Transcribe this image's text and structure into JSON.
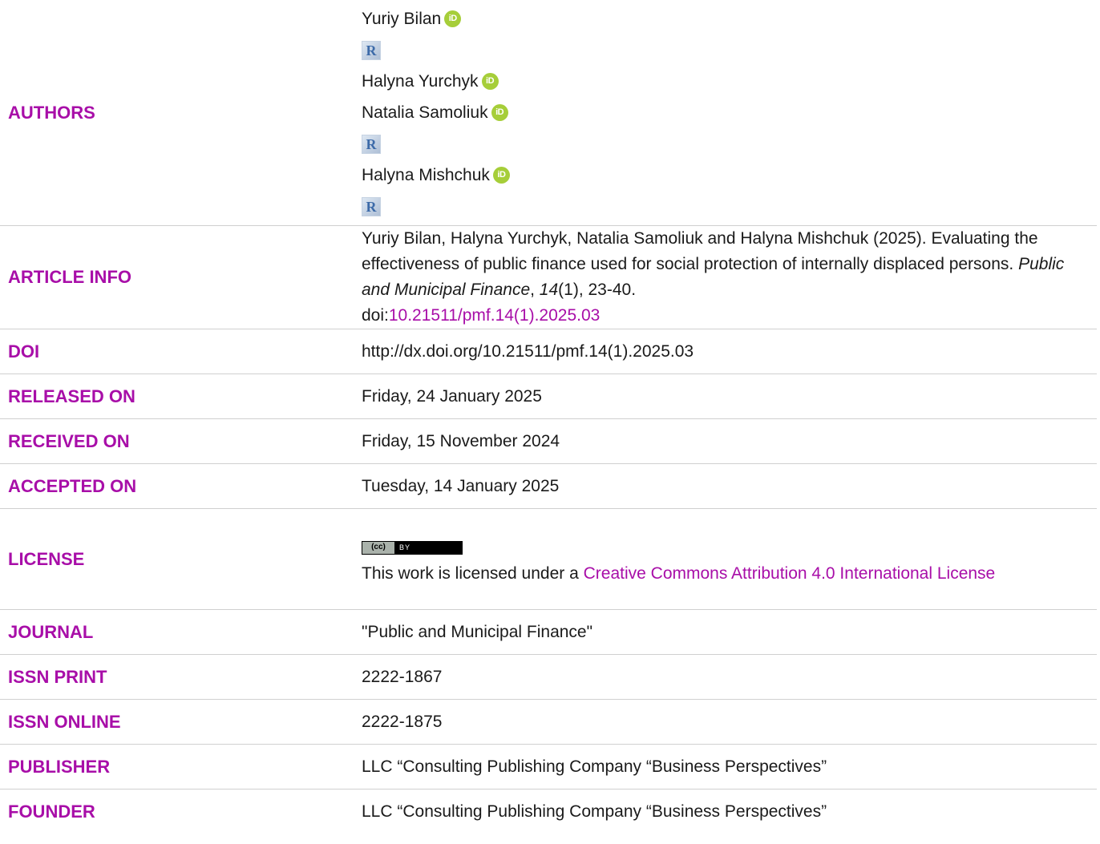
{
  "labels": {
    "authors": "AUTHORS",
    "article_info": "ARTICLE INFO",
    "doi": "DOI",
    "released_on": "RELEASED ON",
    "received_on": "RECEIVED ON",
    "accepted_on": "ACCEPTED ON",
    "license": "LICENSE",
    "journal": "JOURNAL",
    "issn_print": "ISSN PRINT",
    "issn_online": "ISSN ONLINE",
    "publisher": "PUBLISHER",
    "founder": "FOUNDER"
  },
  "authors": [
    {
      "name": "Yuriy Bilan",
      "orcid": "iD",
      "researcher_id": "R"
    },
    {
      "name": "Halyna Yurchyk",
      "orcid": "iD"
    },
    {
      "name": "Natalia Samoliuk",
      "orcid": "iD",
      "researcher_id": "R"
    },
    {
      "name": "Halyna Mishchuk",
      "orcid": "iD",
      "researcher_id": "R"
    }
  ],
  "article_info": {
    "citation_prefix": "Yuriy Bilan, Halyna Yurchyk, Natalia Samoliuk and Halyna Mishchuk (2025). Evaluating the effectiveness of public finance used for social protection of internally displaced persons. ",
    "journal_italic": "Public and Municipal Finance",
    "comma": ", ",
    "volume_italic": "14",
    "issue_pages": "(1), 23-40.",
    "doi_prefix": "doi:",
    "doi_link": "10.21511/pmf.14(1).2025.03"
  },
  "doi": "http://dx.doi.org/10.21511/pmf.14(1).2025.03",
  "released_on": "Friday, 24 January 2025",
  "received_on": "Friday, 15 November 2024",
  "accepted_on": "Tuesday, 14 January 2025",
  "license": {
    "badge_left": "(cc)",
    "badge_right": "BY",
    "text_prefix": "This work is licensed under a ",
    "link_text": "Creative Commons Attribution 4.0 International License"
  },
  "journal": "\"Public and Municipal Finance\"",
  "issn_print": "2222-1867",
  "issn_online": "2222-1875",
  "publisher": "LLC “Consulting Publishing Company “Business Perspectives”",
  "founder": "LLC “Consulting Publishing Company “Business Perspectives”",
  "colors": {
    "label": "#a80ea8",
    "link": "#a80ea8",
    "orcid": "#a6ce39"
  }
}
